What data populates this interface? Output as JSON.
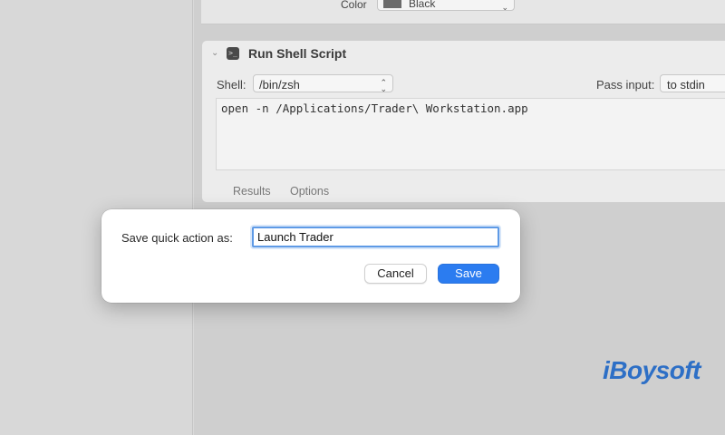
{
  "previous_action": {
    "color_label": "Color",
    "color_value": "Black",
    "color_swatch": "#6b6b6b"
  },
  "action": {
    "title": "Run Shell Script",
    "icon": "terminal-icon",
    "shell_label": "Shell:",
    "shell_value": "/bin/zsh",
    "pass_input_label": "Pass input:",
    "pass_input_value": "to stdin",
    "script": "open -n /Applications/Trader\\ Workstation.app",
    "tabs": [
      "Results",
      "Options"
    ]
  },
  "dialog": {
    "label": "Save quick action as:",
    "input_value": "Launch Trader",
    "cancel_label": "Cancel",
    "save_label": "Save"
  },
  "watermark": "iBoysoft",
  "colors": {
    "accent": "#2b7cf0",
    "focus_ring": "#5e9ae6",
    "watermark": "#2d6fc6"
  }
}
